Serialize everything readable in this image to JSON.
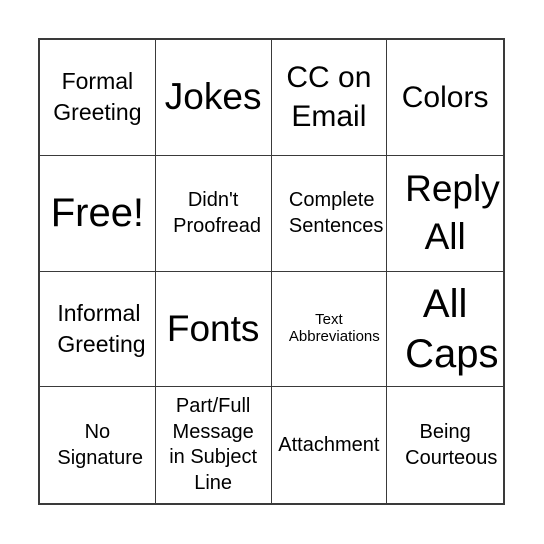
{
  "board": {
    "cells": [
      "Formal Greeting",
      "Jokes",
      "CC on Email",
      "Colors",
      "Free!",
      "Didn't Proofread",
      "Complete Sentences",
      "Reply All",
      "Informal Greeting",
      "Fonts",
      "Text Abbreviations",
      "All Caps",
      "No Signature",
      "Part/Full Message in Subject Line",
      "Attachment",
      "Being Courteous"
    ]
  }
}
